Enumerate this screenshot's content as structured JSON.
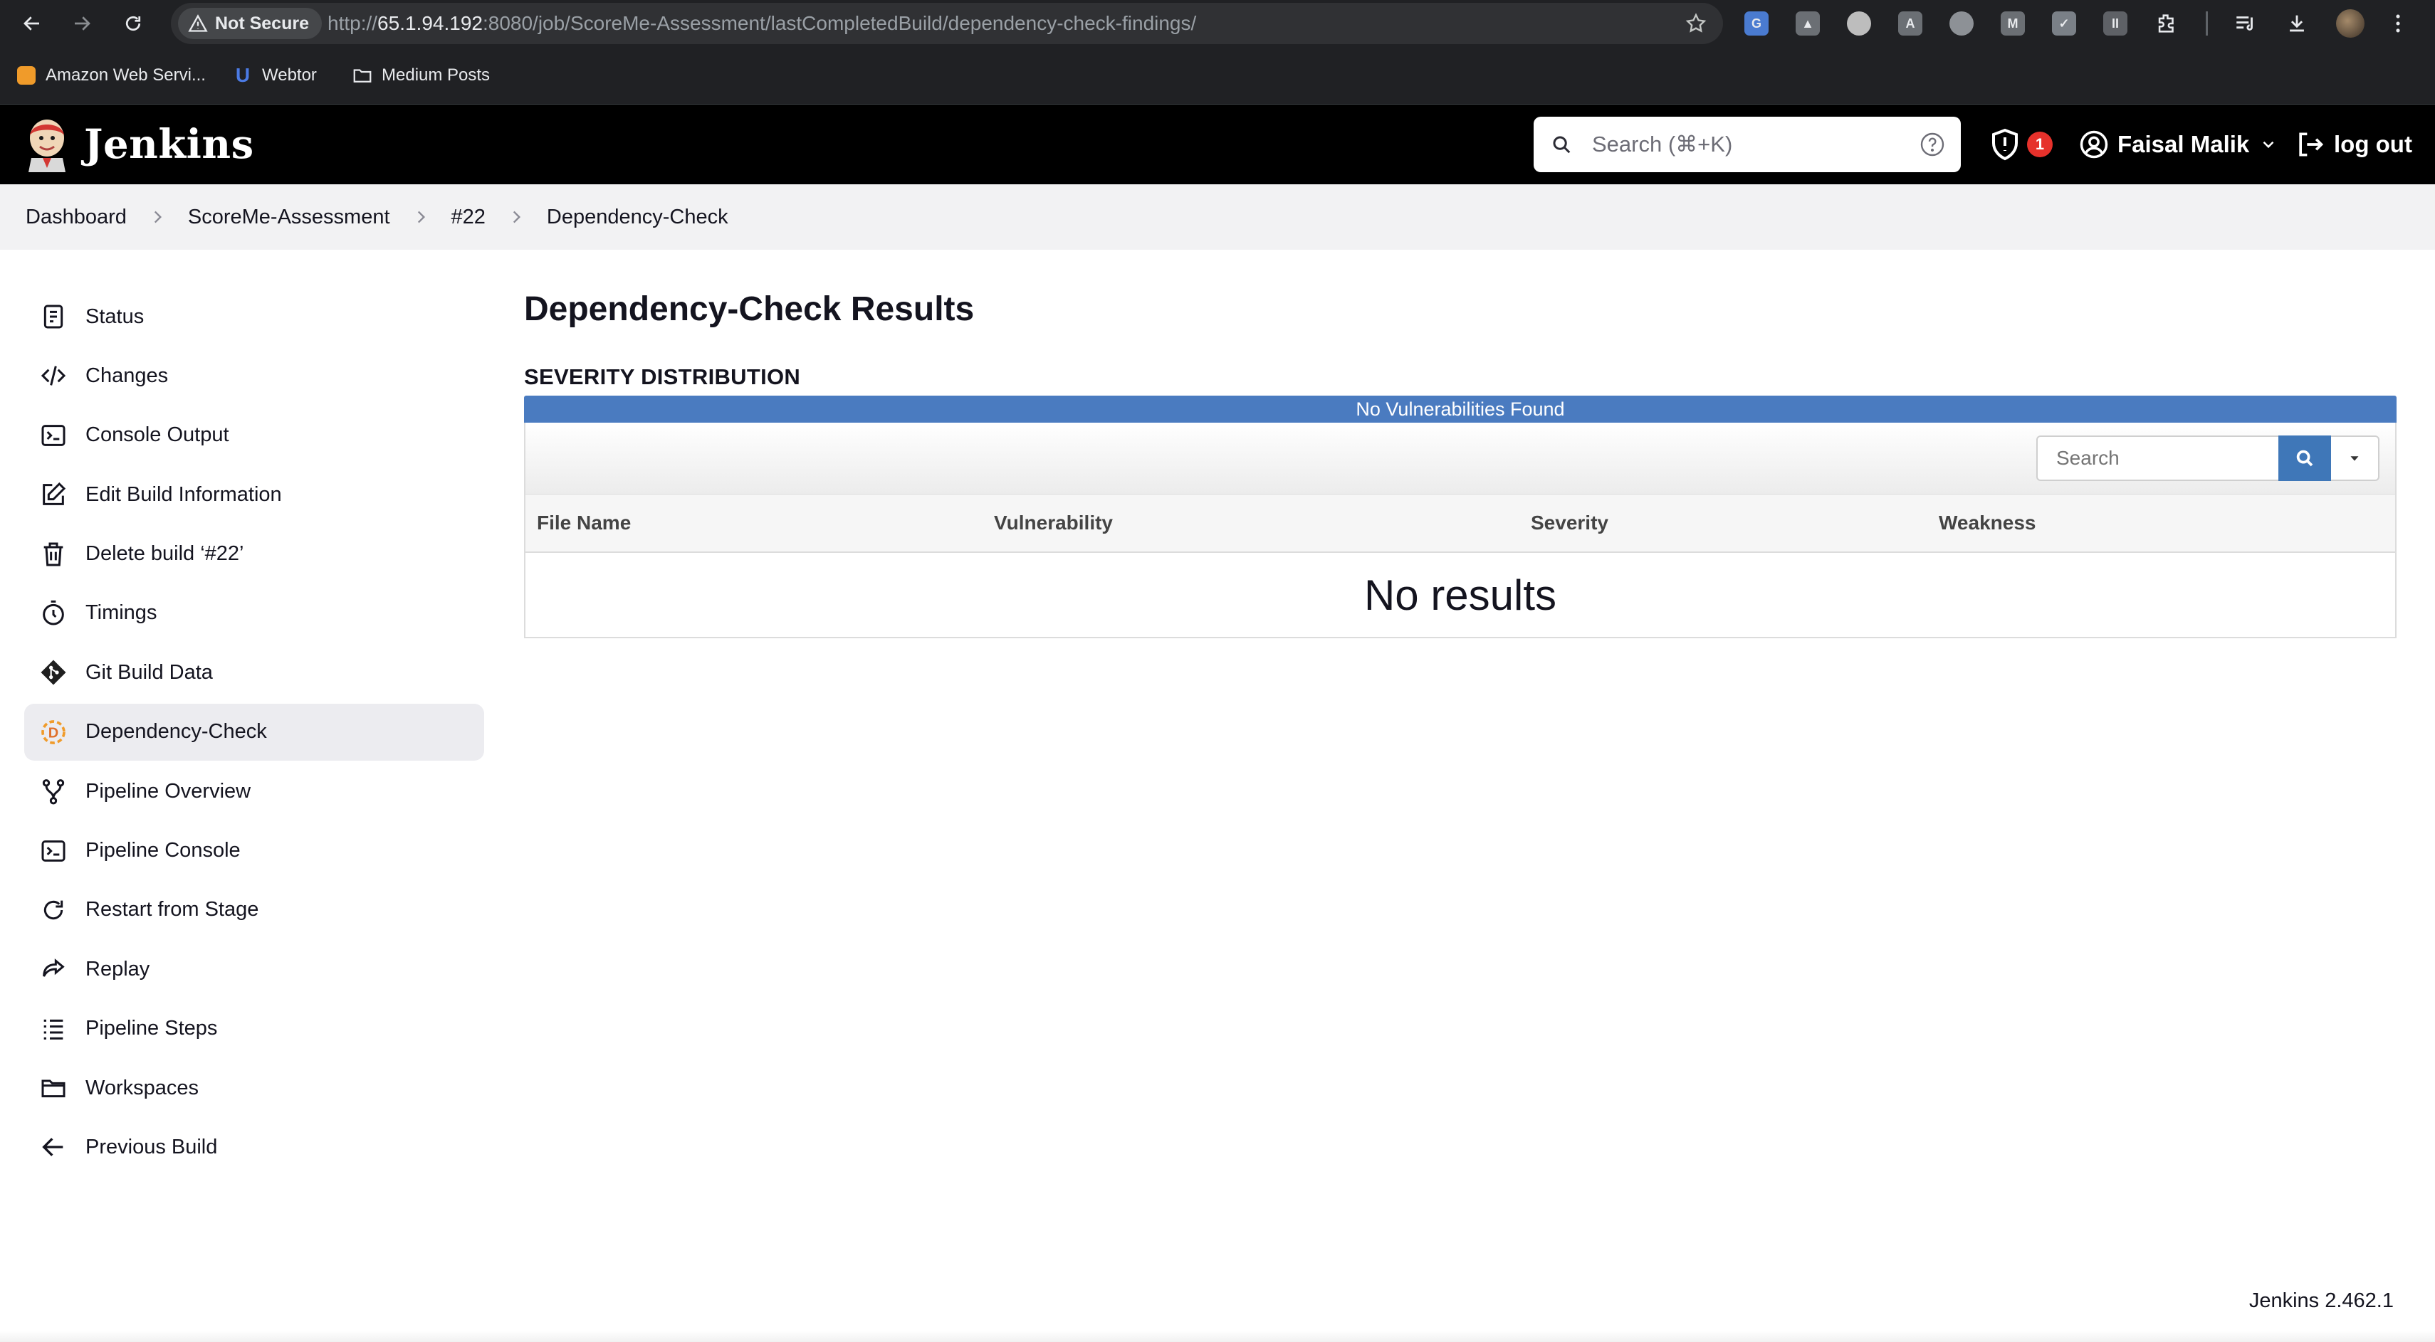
{
  "browser": {
    "security_label": "Not Secure",
    "url_prefix": "http://",
    "url_host": "65.1.94.192",
    "url_rest": ":8080/job/ScoreMe-Assessment/lastCompletedBuild/dependency-check-findings/",
    "bookmarks": [
      "Amazon Web Servi...",
      "Webtor",
      "Medium Posts"
    ]
  },
  "header": {
    "app_title": "Jenkins",
    "search_placeholder": "Search (⌘+K)",
    "security_badge_count": "1",
    "user_name": "Faisal Malik",
    "logout_label": "log out"
  },
  "breadcrumb": [
    "Dashboard",
    "ScoreMe-Assessment",
    "#22",
    "Dependency-Check"
  ],
  "sidebar": {
    "items": [
      {
        "label": "Status",
        "icon": "status-icon"
      },
      {
        "label": "Changes",
        "icon": "code-icon"
      },
      {
        "label": "Console Output",
        "icon": "terminal-icon"
      },
      {
        "label": "Edit Build Information",
        "icon": "edit-icon"
      },
      {
        "label": "Delete build ‘#22’",
        "icon": "trash-icon"
      },
      {
        "label": "Timings",
        "icon": "timer-icon"
      },
      {
        "label": "Git Build Data",
        "icon": "git-icon"
      },
      {
        "label": "Dependency-Check",
        "icon": "dependency-check-icon"
      },
      {
        "label": "Pipeline Overview",
        "icon": "pipeline-icon"
      },
      {
        "label": "Pipeline Console",
        "icon": "terminal-icon"
      },
      {
        "label": "Restart from Stage",
        "icon": "restart-icon"
      },
      {
        "label": "Replay",
        "icon": "replay-icon"
      },
      {
        "label": "Pipeline Steps",
        "icon": "list-icon"
      },
      {
        "label": "Workspaces",
        "icon": "folder-icon"
      },
      {
        "label": "Previous Build",
        "icon": "arrow-left-icon"
      }
    ]
  },
  "main": {
    "title": "Dependency-Check Results",
    "severity_heading": "SEVERITY DISTRIBUTION",
    "severity_bar_text": "No Vulnerabilities Found",
    "table_search_placeholder": "Search",
    "columns": [
      "File Name",
      "Vulnerability",
      "Severity",
      "Weakness"
    ],
    "empty_text": "No results"
  },
  "footer": {
    "version": "Jenkins 2.462.1"
  },
  "colors": {
    "header_bg": "#000000",
    "severity_bar": "#4a7bc0",
    "search_button": "#3f77b8",
    "badge": "#e6312b"
  }
}
